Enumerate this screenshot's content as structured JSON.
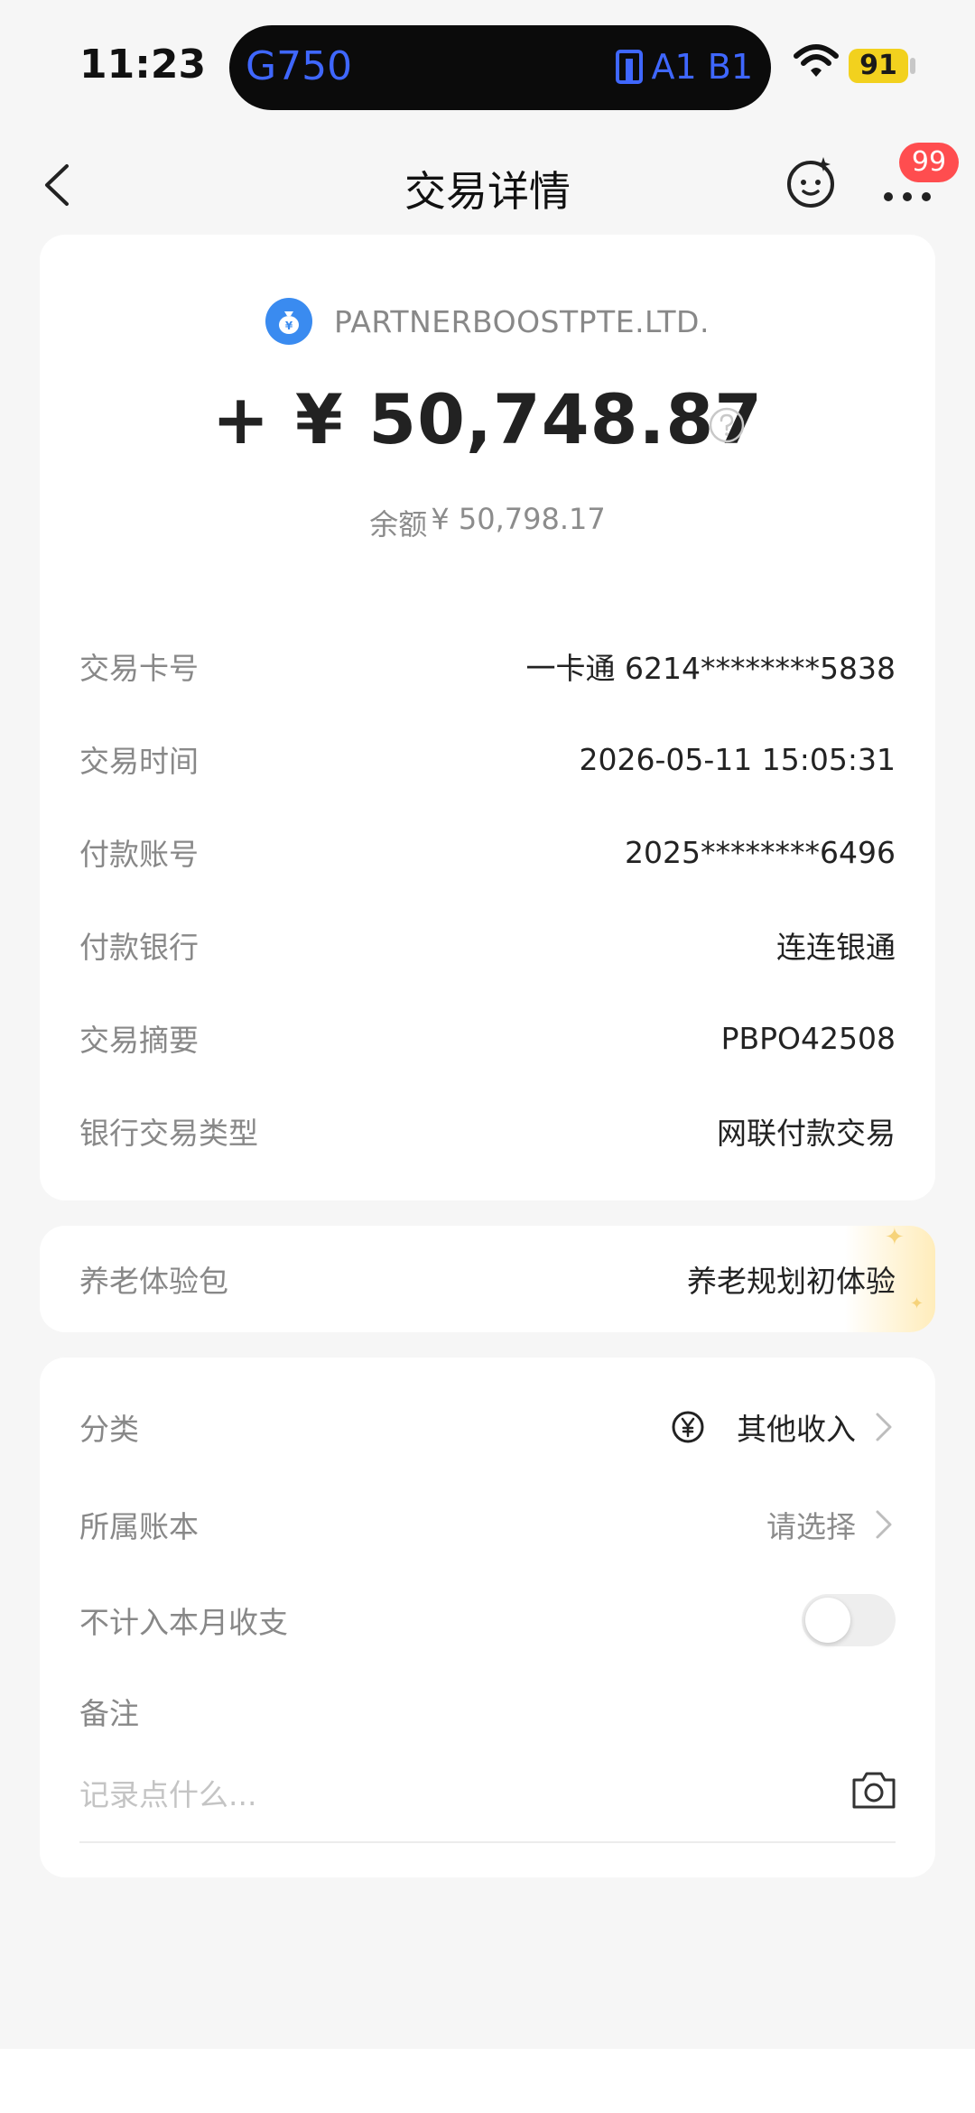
{
  "status_bar": {
    "time": "11:23",
    "island_left": "G750",
    "island_right": "A1 B1",
    "battery": "91"
  },
  "nav": {
    "title": "交易详情",
    "badge": "99"
  },
  "transaction": {
    "merchant": "PARTNERBOOSTPTE.LTD.",
    "amount": "+ ¥ 50,748.87",
    "balance_label": "余额",
    "balance_value": "¥ 50,798.17",
    "details": [
      {
        "label": "交易卡号",
        "value": "一卡通 6214********5838"
      },
      {
        "label": "交易时间",
        "value": "2026-05-11 15:05:31"
      },
      {
        "label": "付款账号",
        "value": "2025********6496"
      },
      {
        "label": "付款银行",
        "value": "连连银通"
      },
      {
        "label": "交易摘要",
        "value": "PBPO42508"
      },
      {
        "label": "银行交易类型",
        "value": "网联付款交易"
      }
    ]
  },
  "pension": {
    "label": "养老体验包",
    "value": "养老规划初体验"
  },
  "settings": {
    "category_label": "分类",
    "category_value": "其他收入",
    "ledger_label": "所属账本",
    "ledger_value": "请选择",
    "exclude_label": "不计入本月收支",
    "exclude_enabled": false,
    "note_label": "备注",
    "note_placeholder": "记录点什么..."
  },
  "colors": {
    "accent_blue": "#3a8bf0",
    "badge_red": "#ff4d4f",
    "battery_yellow": "#f2d11e"
  }
}
